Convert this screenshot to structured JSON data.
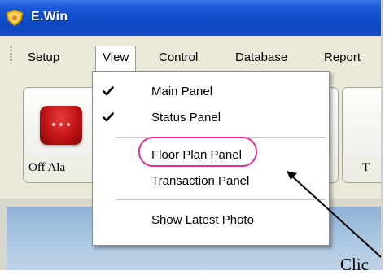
{
  "window": {
    "title": "E.Win"
  },
  "menubar": {
    "items": [
      {
        "label": "Setup"
      },
      {
        "label": "View"
      },
      {
        "label": "Control"
      },
      {
        "label": "Database"
      },
      {
        "label": "Report"
      }
    ]
  },
  "toolbar": {
    "tiles": [
      {
        "label": "Off Ala"
      },
      {
        "label": "T"
      }
    ]
  },
  "view_menu": {
    "items": [
      {
        "label": "Main Panel",
        "checked": true
      },
      {
        "label": "Status Panel",
        "checked": true
      },
      {
        "label": "Floor Plan Panel",
        "checked": false
      },
      {
        "label": "Transaction Panel",
        "checked": false
      },
      {
        "label": "Show Latest Photo",
        "checked": false
      }
    ]
  },
  "callout": {
    "text": "Clic"
  },
  "colors": {
    "titlebar": "#0f4dc9",
    "highlight": "#e22d9a",
    "alarm": "#bf1313"
  }
}
